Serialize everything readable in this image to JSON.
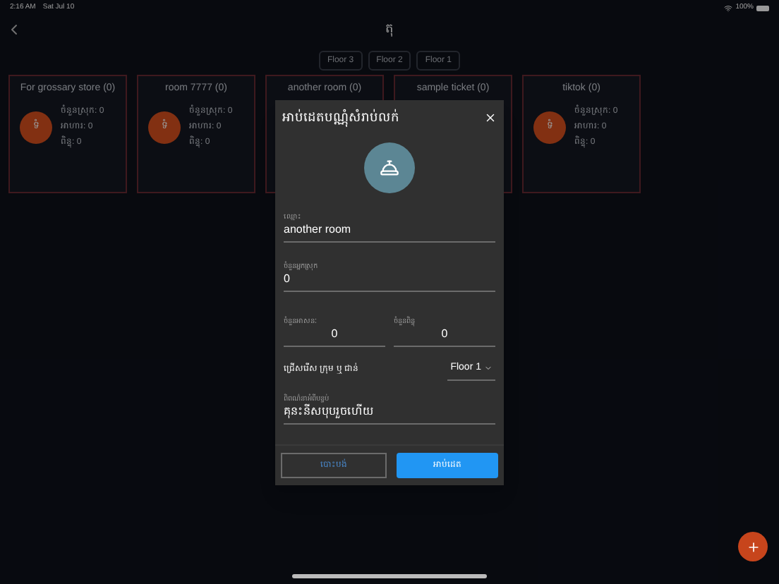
{
  "status_bar": {
    "time": "2:16 AM",
    "date": "Sat Jul 10",
    "battery": "100%"
  },
  "header": {
    "title": "តុ"
  },
  "floors": [
    {
      "label": "Floor 3"
    },
    {
      "label": "Floor 2"
    },
    {
      "label": "Floor 1"
    }
  ],
  "rooms": [
    {
      "title": "For grossary store (0)",
      "avatar": "ទំ",
      "stats": [
        "ចំនួនស្រុក: 0",
        "អាហារ: 0",
        "ពិន្ទុ: 0"
      ]
    },
    {
      "title": "room 7777 (0)",
      "avatar": "ទំ",
      "stats": [
        "ចំនួនស្រុក: 0",
        "អាហារ: 0",
        "ពិន្ទុ: 0"
      ]
    },
    {
      "title": "another room (0)"
    },
    {
      "title": "sample ticket (0)"
    },
    {
      "title": "tiktok (0)",
      "avatar": "ទំ",
      "stats": [
        "ចំនួនស្រុក: 0",
        "អាហារ: 0",
        "ពិន្ទុ: 0"
      ]
    }
  ],
  "dialog": {
    "title": "អាប់ដេតបណ្ណុំសំរាប់លក់",
    "name": {
      "label": "ឈ្មោះ",
      "value": "another room"
    },
    "count": {
      "label": "ចំនួនអ្នកស្រុក",
      "value": "0"
    },
    "pair": [
      {
        "label": "ចំនួនអាសនៈ",
        "value": "0"
      },
      {
        "label": "ចំនួនពិន្ទុ",
        "value": "0"
      }
    ],
    "floor_select": {
      "label": "ជ្រើសរើស ក្រុម ឬ ជាន់",
      "value": "Floor 1"
    },
    "description": {
      "label": "ពិពណ៌នាអំពីបន្ទប់",
      "value": "គុនះនីសបុបរួចហើយ"
    },
    "cancel": "បោះបង់",
    "submit": "អាប់ដេត"
  }
}
